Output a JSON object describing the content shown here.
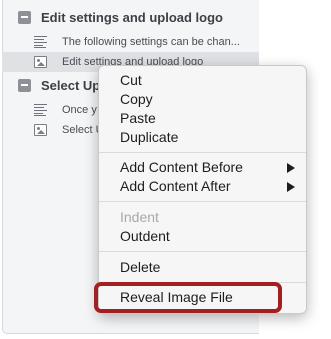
{
  "outline": {
    "sections": [
      {
        "title": "Edit settings and upload logo",
        "items": [
          {
            "icon": "text-page-icon",
            "label": "The following settings can be chan...",
            "selected": false
          },
          {
            "icon": "image-icon",
            "label": "Edit settings and upload logo",
            "selected": true
          }
        ]
      },
      {
        "title": "Select Up",
        "items": [
          {
            "icon": "text-page-icon",
            "label": "Once y",
            "selected": false
          },
          {
            "icon": "image-icon",
            "label": "Select U",
            "selected": false
          }
        ]
      }
    ]
  },
  "context_menu": {
    "cut": "Cut",
    "copy": "Copy",
    "paste": "Paste",
    "duplicate": "Duplicate",
    "add_before": "Add Content Before",
    "add_after": "Add Content After",
    "indent": "Indent",
    "outdent": "Outdent",
    "delete": "Delete",
    "reveal": "Reveal Image File",
    "submenu_icon": "triangle-right-icon",
    "disabled_items": [
      "Indent"
    ]
  },
  "colors": {
    "highlight": "#a31f22",
    "panel_bg": "#f4f5f7",
    "selected_row": "#dfe1e5",
    "toggle": "#8e9098"
  }
}
